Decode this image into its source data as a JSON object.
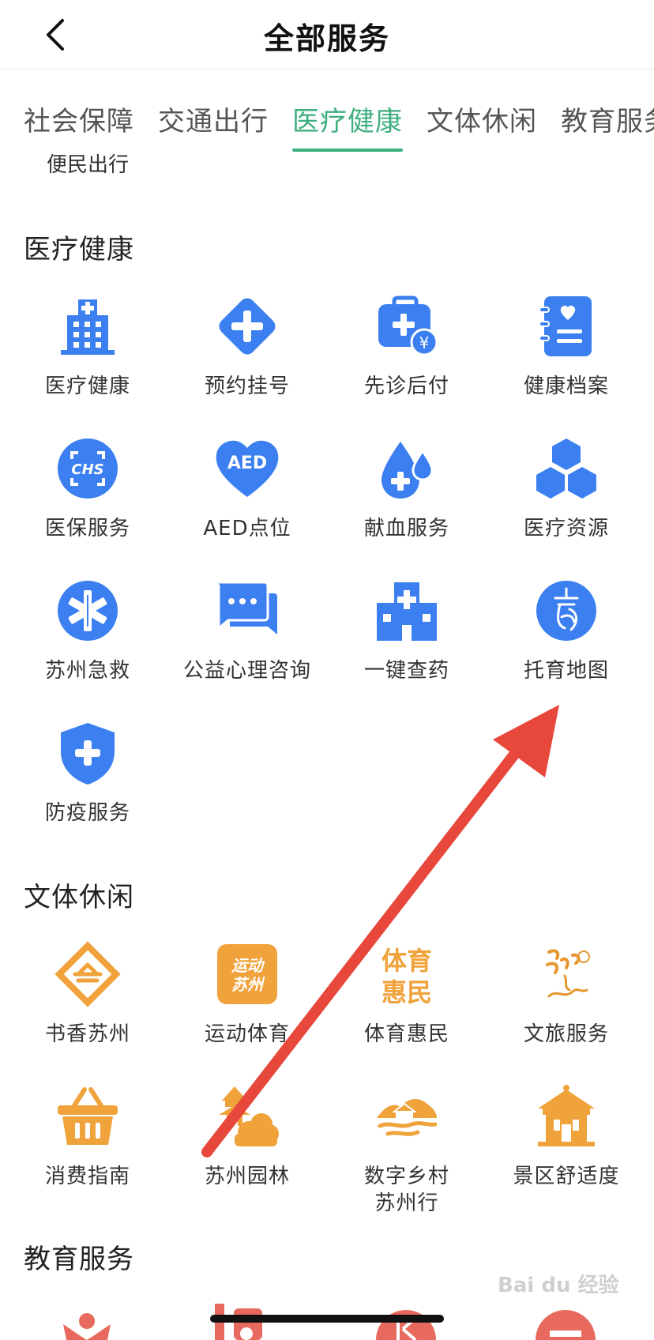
{
  "header": {
    "title": "全部服务",
    "back_icon": "chevron-left-icon"
  },
  "tabs": [
    {
      "label": "社会保障",
      "active": false
    },
    {
      "label": "交通出行",
      "active": false
    },
    {
      "label": "医疗健康",
      "active": true
    },
    {
      "label": "文体休闲",
      "active": false
    },
    {
      "label": "教育服务",
      "active": false
    }
  ],
  "accent_color": "#3dae7e",
  "partial_item": {
    "label": "便民出行"
  },
  "sections": [
    {
      "title": "医疗健康",
      "icon_color": "#3b7ff0",
      "items": [
        {
          "label": "医疗健康",
          "icon": "hospital-building-icon"
        },
        {
          "label": "预约挂号",
          "icon": "diamond-plus-icon"
        },
        {
          "label": "先诊后付",
          "icon": "medical-kit-yen-icon"
        },
        {
          "label": "健康档案",
          "icon": "health-record-icon"
        },
        {
          "label": "医保服务",
          "icon": "chs-badge-icon"
        },
        {
          "label": "AED点位",
          "icon": "aed-heart-icon"
        },
        {
          "label": "献血服务",
          "icon": "blood-drop-icon"
        },
        {
          "label": "医疗资源",
          "icon": "cubes-icon"
        },
        {
          "label": "苏州急救",
          "icon": "star-of-life-icon"
        },
        {
          "label": "公益心理咨询",
          "icon": "chat-bubbles-icon"
        },
        {
          "label": "一键查药",
          "icon": "pharmacy-building-icon"
        },
        {
          "label": "托育地图",
          "icon": "childcare-map-icon"
        },
        {
          "label": "防疫服务",
          "icon": "shield-plus-icon"
        }
      ]
    },
    {
      "title": "文体休闲",
      "icon_color": "#f0a23b",
      "items": [
        {
          "label": "书香苏州",
          "icon": "book-fragrance-icon"
        },
        {
          "label": "运动体育",
          "icon": "sport-suzhou-icon",
          "badge": "运动苏州"
        },
        {
          "label": "体育惠民",
          "icon": "sport-benefit-icon",
          "badge": "体育惠民"
        },
        {
          "label": "文旅服务",
          "icon": "culture-travel-icon"
        },
        {
          "label": "消费指南",
          "icon": "shopping-basket-icon"
        },
        {
          "label": "苏州园林",
          "icon": "garden-pavilion-icon"
        },
        {
          "label": "数字乡村\n苏州行",
          "icon": "village-landscape-icon"
        },
        {
          "label": "景区舒适度",
          "icon": "scenic-pavilion-icon"
        }
      ]
    },
    {
      "title": "教育服务",
      "icon_color": "#e86a5e",
      "items": []
    }
  ],
  "annotation": {
    "arrow_color": "#e8483c",
    "points_to": "托育地图"
  },
  "watermark": "Bai du 经验"
}
